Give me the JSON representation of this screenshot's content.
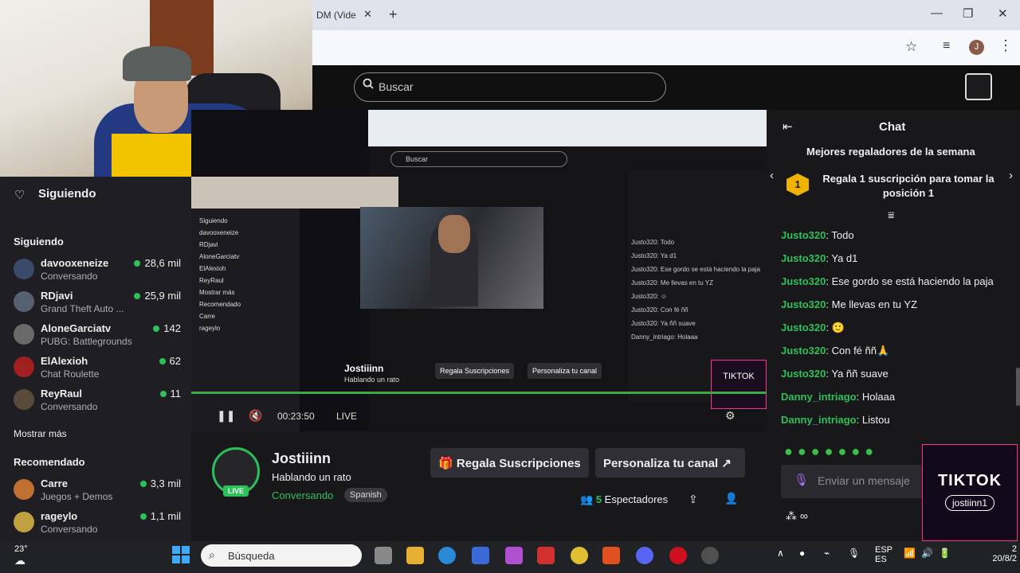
{
  "browser": {
    "tab_title": "DM (Vide",
    "new_tab": "+",
    "profile_initial": "J"
  },
  "header": {
    "search_placeholder": "Buscar"
  },
  "sidebar": {
    "title": "Siguiendo",
    "section_following": "Siguiendo",
    "following": [
      {
        "name": "davooxeneize",
        "game": "Conversando",
        "viewers": "28,6 mil",
        "color": "#3a4a6a"
      },
      {
        "name": "RDjavi",
        "game": "Grand Theft Auto ...",
        "viewers": "25,9 mil",
        "color": "#556070"
      },
      {
        "name": "AloneGarciatv",
        "game": "PUBG: Battlegrounds",
        "viewers": "142",
        "color": "#6a6a6a"
      },
      {
        "name": "ElAlexioh",
        "game": "Chat Roulette",
        "viewers": "62",
        "color": "#a02020"
      },
      {
        "name": "ReyRaul",
        "game": "Conversando",
        "viewers": "11",
        "color": "#5a4a3a"
      }
    ],
    "show_more": "Mostrar más",
    "section_recommended": "Recomendado",
    "recommended": [
      {
        "name": "Carre",
        "game": "Juegos + Demos",
        "viewers": "3,3 mil",
        "color": "#c07030"
      },
      {
        "name": "rageylo",
        "game": "Conversando",
        "viewers": "1,1 mil",
        "color": "#c0a040"
      }
    ]
  },
  "video": {
    "time": "00:23:50",
    "live": "LIVE",
    "nested_search": "Buscar",
    "nested_name": "Jostiiinn",
    "nested_status": "Hablando un rato",
    "nested_btn1": "Regala Suscripciones",
    "nested_btn2": "Personaliza tu canal",
    "nested_chat": [
      "Justo320: Todo",
      "Justo320: Ya d1",
      "Justo320: Ese gordo se está haciendo la paja",
      "Justo320: Me llevas en tu YZ",
      "Justo320: ☺",
      "Justo320: Con fé ññ",
      "Justo320: Ya ññ suave",
      "Danny_intriago: Holaaa"
    ],
    "nested_side": [
      "Siguiendo",
      "davooxeneize",
      "RDjavi",
      "AloneGarciatv",
      "ElAlexioh",
      "ReyRaul",
      "Mostrar más",
      "Recomendado",
      "Carre",
      "rageylo"
    ]
  },
  "streamer": {
    "name": "Jostiiinn",
    "live_badge": "LIVE",
    "title": "Hablando un rato",
    "category": "Conversando",
    "tag": "Spanish",
    "gift_button": "Regala Suscripciones",
    "customize_button": "Personaliza tu canal",
    "viewers_count": "5",
    "viewers_label": "Espectadores"
  },
  "chat": {
    "title": "Chat",
    "top_gifters_title": "Mejores regaladores de la semana",
    "top_gift_text": "Regala 1 suscripción para tomar la posición 1",
    "rank": "1",
    "messages": [
      {
        "user": "Justo320",
        "text": "Todo"
      },
      {
        "user": "Justo320",
        "text": "Ya d1"
      },
      {
        "user": "Justo320",
        "text": "Ese gordo se está haciendo la paja"
      },
      {
        "user": "Justo320",
        "text": "Me llevas en tu YZ"
      },
      {
        "user": "Justo320",
        "text": "🙂"
      },
      {
        "user": "Justo320",
        "text": "Con fé ññ🙏"
      },
      {
        "user": "Justo320",
        "text": "Ya ññ suave"
      },
      {
        "user": "Danny_intriago",
        "text": "Holaaa"
      },
      {
        "user": "Danny_intriago",
        "text": "Listou"
      }
    ],
    "input_placeholder": "Enviar un mensaje",
    "points": "∞",
    "user_color": "#2ec05a"
  },
  "tiktok": {
    "brand": "TIKTOK",
    "handle": "jostiinn1"
  },
  "taskbar": {
    "temp": "23°",
    "search_placeholder": "Búsqueda",
    "lang_top": "ESP",
    "lang_bottom": "ES",
    "date": "20/8/2",
    "time": "2"
  }
}
